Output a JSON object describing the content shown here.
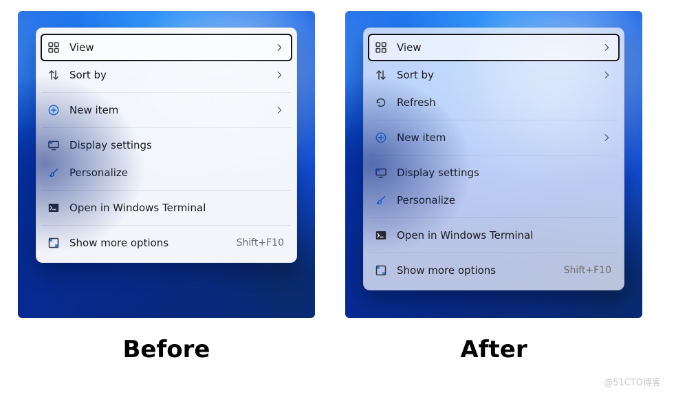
{
  "captions": {
    "before": "Before",
    "after": "After"
  },
  "shortcut_label": "Shift+F10",
  "watermark": "@51CTO博客",
  "menus": {
    "before": {
      "groups": [
        {
          "items": [
            {
              "key": "view",
              "label": "View",
              "icon": "grid-icon",
              "submenu": true,
              "focused": true
            },
            {
              "key": "sortby",
              "label": "Sort by",
              "icon": "sort-icon",
              "submenu": true,
              "focused": false
            }
          ]
        },
        {
          "items": [
            {
              "key": "newitem",
              "label": "New item",
              "icon": "plus-circle-icon",
              "submenu": true,
              "focused": false
            }
          ]
        },
        {
          "items": [
            {
              "key": "display",
              "label": "Display settings",
              "icon": "display-gear-icon",
              "submenu": false,
              "focused": false
            },
            {
              "key": "personal",
              "label": "Personalize",
              "icon": "brush-icon",
              "submenu": false,
              "focused": false
            }
          ]
        },
        {
          "items": [
            {
              "key": "terminal",
              "label": "Open in Windows Terminal",
              "icon": "terminal-icon",
              "submenu": false,
              "focused": false
            }
          ]
        },
        {
          "items": [
            {
              "key": "more",
              "label": "Show more options",
              "icon": "expand-icon",
              "submenu": false,
              "focused": false,
              "shortcut": true
            }
          ]
        }
      ]
    },
    "after": {
      "groups": [
        {
          "items": [
            {
              "key": "view",
              "label": "View",
              "icon": "grid-icon",
              "submenu": true,
              "focused": true
            },
            {
              "key": "sortby",
              "label": "Sort by",
              "icon": "sort-icon",
              "submenu": true,
              "focused": false
            },
            {
              "key": "refresh",
              "label": "Refresh",
              "icon": "refresh-icon",
              "submenu": false,
              "focused": false
            }
          ]
        },
        {
          "items": [
            {
              "key": "newitem",
              "label": "New item",
              "icon": "plus-circle-icon",
              "submenu": true,
              "focused": false
            }
          ]
        },
        {
          "items": [
            {
              "key": "display",
              "label": "Display settings",
              "icon": "display-gear-icon",
              "submenu": false,
              "focused": false
            },
            {
              "key": "personal",
              "label": "Personalize",
              "icon": "brush-icon",
              "submenu": false,
              "focused": false
            }
          ]
        },
        {
          "items": [
            {
              "key": "terminal",
              "label": "Open in Windows Terminal",
              "icon": "terminal-icon",
              "submenu": false,
              "focused": false
            }
          ]
        },
        {
          "items": [
            {
              "key": "more",
              "label": "Show more options",
              "icon": "expand-icon",
              "submenu": false,
              "focused": false,
              "shortcut": true
            }
          ]
        }
      ]
    }
  }
}
